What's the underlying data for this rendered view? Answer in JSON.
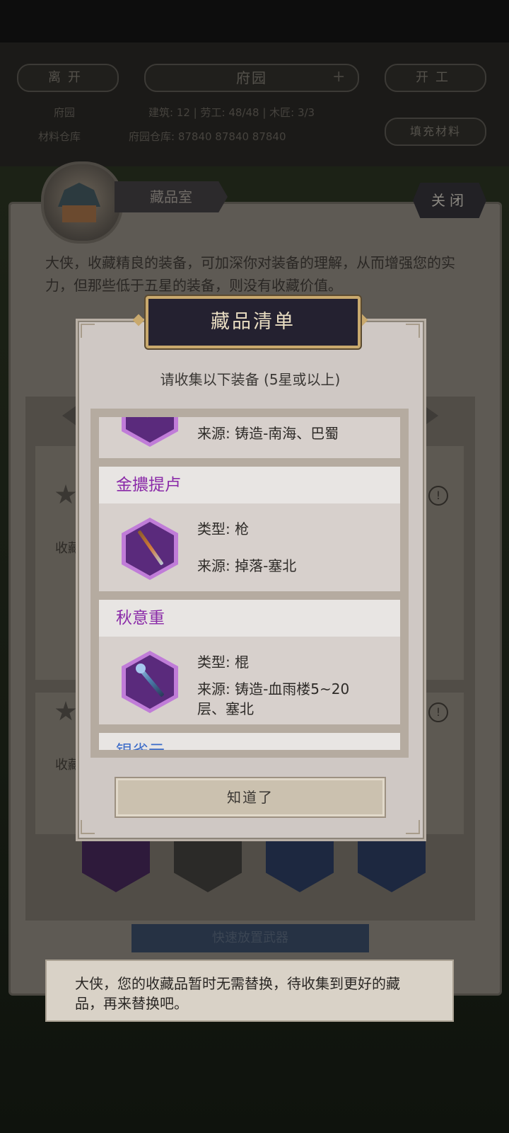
{
  "hud": {
    "leave_label": "离开",
    "title": "府园",
    "plus": "+",
    "start_label": "开工",
    "stat_left": "府园",
    "stats": "建筑: 12  |  劳工: 48/48  |  木匠: 3/3",
    "left_sub": "材料仓库",
    "storage": "府园仓库: 87840   87840   87840",
    "fill_label": "填充材料"
  },
  "room": {
    "tab_label": "藏品室",
    "close_label": "关闭",
    "description": "大侠，收藏精良的装备，可加深你对装备的理解，从而增强您的实力，但那些低于五星的装备，则没有收藏价值。",
    "row_label_1": "收藏",
    "row_label_2": "收藏",
    "quick_button": "快速放置武器"
  },
  "dialog": {
    "title": "藏品清单",
    "subtitle": "请收集以下装备 (5星或以上)",
    "items": [
      {
        "source": "来源: 铸造-南海、巴蜀"
      },
      {
        "name": "金擃提卢",
        "type": "类型: 枪",
        "source": "来源: 掉落-塞北"
      },
      {
        "name": "秋意重",
        "type": "类型: 棍",
        "source": "来源: 铸造-血雨楼5~20层、塞北"
      },
      {
        "name": "银雀云"
      }
    ],
    "confirm_label": "知道了"
  },
  "toast": {
    "message": "大侠，您的收藏品暂时无需替换，待收集到更好的藏品，再来替换吧。"
  },
  "colors": {
    "item_name": "#8a2aa8",
    "item_name_cut": "#3a6ac8",
    "title_border": "#c9a96d",
    "hex_rim": "#c07cd8",
    "hex_fill": "#5a2a7c"
  }
}
